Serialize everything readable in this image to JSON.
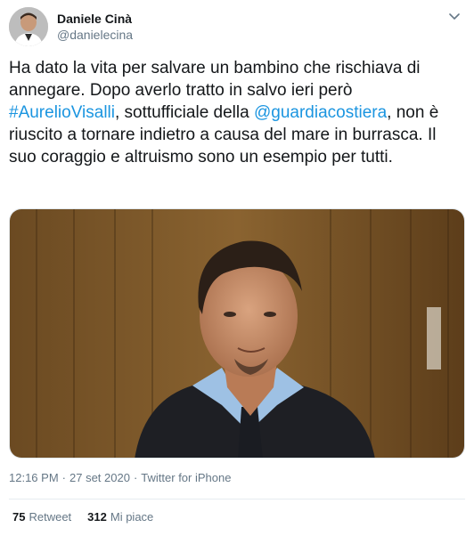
{
  "author": {
    "display_name": "Daniele Cinà",
    "handle": "@danielecina"
  },
  "tweet": {
    "text_part1": "Ha dato la vita per salvare un bambino che rischiava di annegare. Dopo averlo tratto in salvo ieri però ",
    "hashtag": "#AurelioVisalli",
    "text_part2": ", sottufficiale della ",
    "mention": "@guardiacostiera",
    "text_part3": ", non è riuscito a tornare indietro a causa del mare in burrasca. Il suo coraggio e altruismo sono un esempio per tutti."
  },
  "meta": {
    "time": "12:16 PM",
    "separator1": "·",
    "date": "27 set 2020",
    "separator2": "·",
    "source": "Twitter for iPhone"
  },
  "stats": {
    "retweets_count": "75",
    "retweets_label": "Retweet",
    "likes_count": "312",
    "likes_label": "Mi piace"
  },
  "colors": {
    "link": "#1b95e0",
    "secondary_text": "#657786",
    "primary_text": "#14171a"
  },
  "icons": {
    "menu": "chevron-down-icon"
  }
}
